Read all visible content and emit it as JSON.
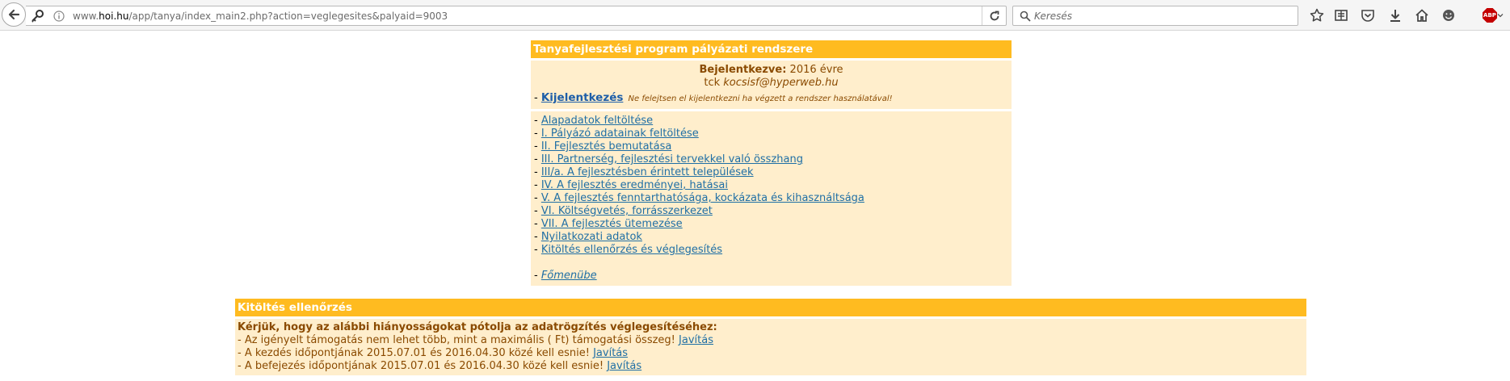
{
  "browser": {
    "url_prefix": "www.",
    "url_domain": "hoi.hu",
    "url_rest": "/app/tanya/index_main2.php?action=veglegesites&palyaid=9003",
    "search_placeholder": "Keresés",
    "abp_label": "ABP"
  },
  "menu_panel": {
    "title": "Tanyafejlesztési program pályázati rendszere",
    "logged_in_label": "Bejelentkezve:",
    "logged_in_year": "2016 évre",
    "user_prefix": "tck",
    "user_email": "kocsisf@hyperweb.hu",
    "dash": "-",
    "logout_label": "Kijelentkezés",
    "logout_note": "Ne felejtsen el kijelentkezni ha végzett a rendszer használatával!",
    "links": [
      "Alapadatok feltöltése",
      "I. Pályázó adatainak feltöltése",
      "II. Fejlesztés bemutatása",
      "III. Partnerség, fejlesztési tervekkel való összhang",
      "III/a. A fejlesztésben érintett települések",
      "IV. A fejlesztés eredményei, hatásai",
      "V. A fejlesztés fenntarthatósága, kockázata és kihasználtsága",
      "VI. Költségvetés, forrásszerkezet",
      "VII. A fejlesztés ütemezése",
      "Nyilatkozati adatok",
      "Kitöltés ellenőrzés és véglegesítés"
    ],
    "home_label": "Főmenübe"
  },
  "check_panel": {
    "title": "Kitöltés ellenőrzés",
    "intro": "Kérjük, hogy az alábbi hiányosságokat pótolja az adatrögzítés véglegesítéséhez:",
    "fix_label": "Javítás",
    "items": [
      "- Az igényelt támogatás nem lehet több, mint a maximális ( Ft) támogatási összeg!",
      "- A kezdés időpontjának 2015.07.01 és 2016.04.30 közé kell esnie!",
      "- A befejezés időpontjának 2015.07.01 és 2016.04.30 közé kell esnie!"
    ]
  }
}
